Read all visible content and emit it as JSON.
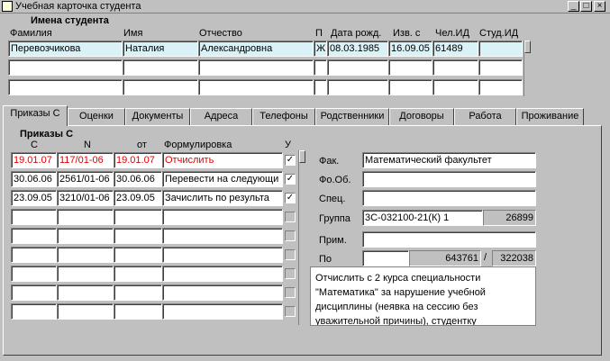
{
  "window": {
    "title": "Учебная карточка студента",
    "controls": {
      "minimize": "_",
      "maximize": "□",
      "close": "×"
    }
  },
  "student_section": {
    "heading": "Имена студента",
    "columns": {
      "last_name": "Фамилия",
      "first_name": "Имя",
      "patronymic": "Отчество",
      "gender": "П",
      "birth_date": "Дата рожд.",
      "changed": "Изв. с",
      "person_id": "Чел.ИД",
      "student_id": "Студ.ИД"
    },
    "rows": [
      {
        "last_name": "Перевозчикова",
        "first_name": "Наталия",
        "patronymic": "Александровна",
        "gender": "Ж",
        "birth_date": "08.03.1985",
        "changed": "16.09.05",
        "person_id": "61489",
        "student_id": ""
      },
      {
        "last_name": "",
        "first_name": "",
        "patronymic": "",
        "gender": "",
        "birth_date": "",
        "changed": "",
        "person_id": "",
        "student_id": ""
      },
      {
        "last_name": "",
        "first_name": "",
        "patronymic": "",
        "gender": "",
        "birth_date": "",
        "changed": "",
        "person_id": "",
        "student_id": ""
      }
    ]
  },
  "tabs": [
    {
      "label": "Приказы С",
      "active": true
    },
    {
      "label": "Оценки"
    },
    {
      "label": "Документы"
    },
    {
      "label": "Адреса"
    },
    {
      "label": "Телефоны"
    },
    {
      "label": "Родственники"
    },
    {
      "label": "Договоры"
    },
    {
      "label": "Работа"
    },
    {
      "label": "Проживание"
    }
  ],
  "orders": {
    "heading": "Приказы С",
    "columns": {
      "from": "С",
      "number": "N",
      "date": "от",
      "wording": "Формулировка",
      "flag": "У"
    },
    "rows": [
      {
        "from": "19.01.07",
        "number": "117/01-06",
        "date": "19.01.07",
        "wording": "Отчислить",
        "flag": true,
        "highlight": true
      },
      {
        "from": "30.06.06",
        "number": "2561/01-06",
        "date": "30.06.06",
        "wording": "Перевести на следующи",
        "flag": true
      },
      {
        "from": "23.09.05",
        "number": "3210/01-06",
        "date": "23.09.05",
        "wording": "Зачислить по результа",
        "flag": true
      },
      {
        "from": "",
        "number": "",
        "date": "",
        "wording": "",
        "flag": false
      },
      {
        "from": "",
        "number": "",
        "date": "",
        "wording": "",
        "flag": false
      },
      {
        "from": "",
        "number": "",
        "date": "",
        "wording": "",
        "flag": false
      },
      {
        "from": "",
        "number": "",
        "date": "",
        "wording": "",
        "flag": false
      },
      {
        "from": "",
        "number": "",
        "date": "",
        "wording": "",
        "flag": false
      },
      {
        "from": "",
        "number": "",
        "date": "",
        "wording": "",
        "flag": false
      }
    ]
  },
  "details": {
    "faculty_label": "Фак.",
    "faculty_value": "Математический факультет",
    "study_form_label": "Фо.Об.",
    "study_form_value": "",
    "specialty_label": "Спец.",
    "specialty_value": "",
    "group_label": "Группа",
    "group_value": "3С-032100-21(К) 1",
    "group_code": "26899",
    "note_label": "Прим.",
    "note_value": "",
    "by_label": "По",
    "by_value": "",
    "by_code1": "643761",
    "by_separator": "/",
    "by_code2": "322038",
    "comment": "Отчислить с 2 курса специальности \"Математика\" за нарушение учебной дисциплины (неявка на сессию без уважительной причины), студентку"
  },
  "colors": {
    "window_bg": "#c0c0c0",
    "selected_row": "#d8f2f8",
    "highlight_text": "#e00000"
  }
}
